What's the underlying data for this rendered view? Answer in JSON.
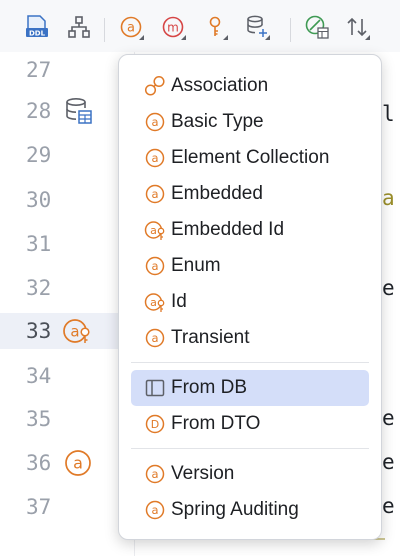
{
  "toolbar": {
    "buttons": [
      {
        "name": "ddl-icon",
        "label": "DDL"
      },
      {
        "name": "hierarchy-icon"
      },
      {
        "name": "attribute-icon",
        "label": "a"
      },
      {
        "name": "method-icon",
        "label": "m"
      },
      {
        "name": "key-icon"
      },
      {
        "name": "db-add-icon"
      },
      {
        "name": "entity-icon"
      },
      {
        "name": "sort-icon"
      }
    ]
  },
  "gutter": {
    "line_numbers": [
      "27",
      "28",
      "29",
      "30",
      "31",
      "32",
      "33",
      "34",
      "35",
      "36",
      "37"
    ],
    "highlighted_line": "33"
  },
  "editor": {
    "fragments": [
      "l",
      "a",
      "e",
      "e",
      "e",
      "e"
    ]
  },
  "menu": {
    "items": [
      {
        "label": "Association",
        "icon": "association-icon"
      },
      {
        "label": "Basic Type",
        "icon": "attribute-icon"
      },
      {
        "label": "Element Collection",
        "icon": "attribute-icon"
      },
      {
        "label": "Embedded",
        "icon": "attribute-icon"
      },
      {
        "label": "Embedded Id",
        "icon": "attribute-key-icon"
      },
      {
        "label": "Enum",
        "icon": "attribute-icon"
      },
      {
        "label": "Id",
        "icon": "attribute-key-icon"
      },
      {
        "label": "Transient",
        "icon": "attribute-icon"
      },
      {
        "label": "From DB",
        "icon": "table-icon",
        "selected": true
      },
      {
        "label": "From DTO",
        "icon": "dto-icon"
      },
      {
        "label": "Version",
        "icon": "attribute-icon"
      },
      {
        "label": "Spring Auditing",
        "icon": "attribute-icon"
      }
    ]
  },
  "colors": {
    "accent_orange": "#e07a28",
    "method_red": "#d64545",
    "icon_green": "#3f9a54",
    "selection": "#d4def9",
    "line_highlight": "#edf0f7"
  }
}
